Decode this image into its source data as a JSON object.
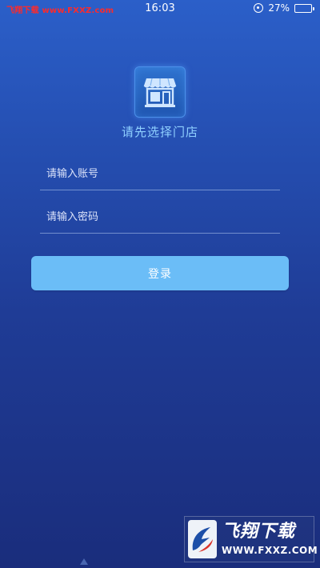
{
  "status_bar": {
    "watermark": "飞翔下载 www.FXXZ.com",
    "time": "16:03",
    "battery": "27%"
  },
  "store": {
    "select_label": "请先选择门店"
  },
  "login_form": {
    "account_placeholder": "请输入账号",
    "password_placeholder": "请输入密码",
    "login_label": "登录"
  },
  "footer_watermark": {
    "brand": "飞翔下载",
    "url": "WWW.FXXZ.COM"
  },
  "colors": {
    "background_top": "#2b5fc9",
    "background_bottom": "#1a2d7c",
    "accent": "#6bbdf7",
    "title": "#8fd0ff"
  },
  "icons": [
    "store-icon",
    "orientation-lock-icon",
    "battery-icon",
    "fxxz-logo-icon"
  ]
}
